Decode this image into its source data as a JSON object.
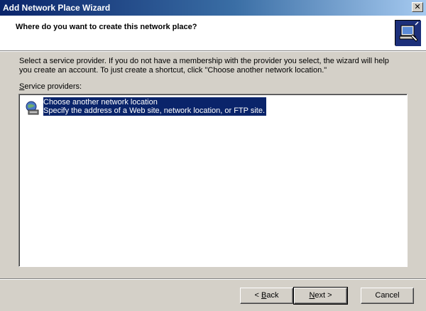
{
  "window": {
    "title": "Add Network Place Wizard",
    "close_glyph": "✕"
  },
  "header": {
    "heading": "Where do you want to create this network place?",
    "icon": "network-wizard-icon"
  },
  "main": {
    "description": "Select a service provider.  If you do not have a membership with the provider you select, the wizard will help you create an account.  To just create a shortcut, click \"Choose another network location.\"",
    "list_label": "Service providers:",
    "list_label_accesskey": "S",
    "list_label_rest": "ervice providers:",
    "providers": [
      {
        "title": "Choose another network location",
        "subtitle": "Specify the address of a Web site, network location, or FTP site.",
        "icon": "network-globe-icon",
        "selected": true
      }
    ]
  },
  "buttons": {
    "back_label": "< Back",
    "back_pre": "< ",
    "back_key": "B",
    "back_rest": "ack",
    "next_label": "Next >",
    "next_key": "N",
    "next_rest": "ext >",
    "cancel_label": "Cancel"
  },
  "colors": {
    "selection": "#0a246a",
    "face": "#d4d0c8",
    "title_start": "#0a246a",
    "title_end": "#a6caf0"
  }
}
